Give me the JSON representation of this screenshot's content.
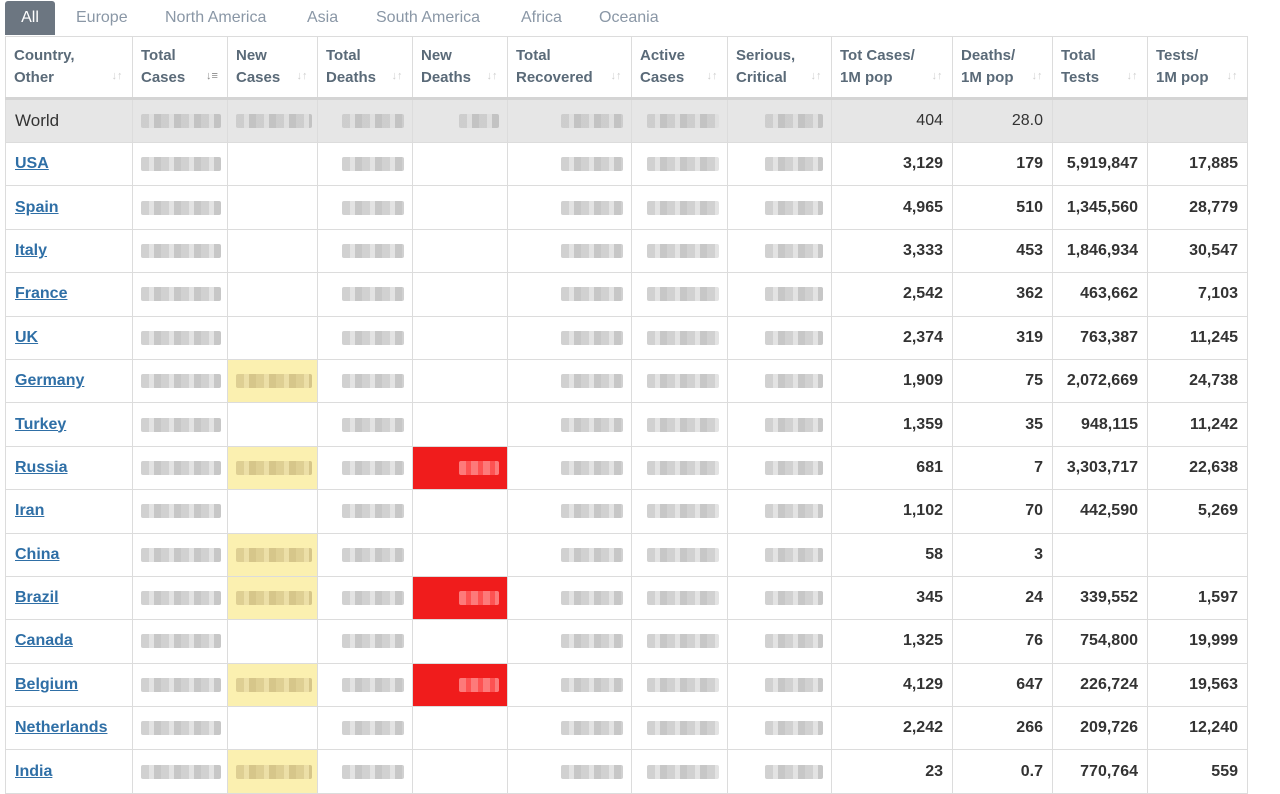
{
  "tabs": [
    {
      "label": "All",
      "active": true
    },
    {
      "label": "Europe"
    },
    {
      "label": "North America"
    },
    {
      "label": "Asia"
    },
    {
      "label": "South America"
    },
    {
      "label": "Africa"
    },
    {
      "label": "Oceania"
    }
  ],
  "headers": [
    {
      "line1": "Country,",
      "line2": "Other"
    },
    {
      "line1": "Total",
      "line2": "Cases",
      "sorted": true
    },
    {
      "line1": "New",
      "line2": "Cases"
    },
    {
      "line1": "Total",
      "line2": "Deaths"
    },
    {
      "line1": "New",
      "line2": "Deaths"
    },
    {
      "line1": "Total",
      "line2": "Recovered"
    },
    {
      "line1": "Active",
      "line2": "Cases"
    },
    {
      "line1": "Serious,",
      "line2": "Critical"
    },
    {
      "line1": "Tot Cases/",
      "line2": "1M pop"
    },
    {
      "line1": "Deaths/",
      "line2": "1M pop"
    },
    {
      "line1": "Total",
      "line2": "Tests"
    },
    {
      "line1": "Tests/",
      "line2": "1M pop"
    }
  ],
  "world": {
    "country": "World",
    "tot_cases_1m": "404",
    "deaths_1m": "28.0",
    "total_tests": "",
    "tests_1m": ""
  },
  "rows": [
    {
      "country": "USA",
      "tot_cases_1m": "3,129",
      "deaths_1m": "179",
      "total_tests": "5,919,847",
      "tests_1m": "17,885",
      "new_cases_highlight": false,
      "new_deaths_highlight": false
    },
    {
      "country": "Spain",
      "tot_cases_1m": "4,965",
      "deaths_1m": "510",
      "total_tests": "1,345,560",
      "tests_1m": "28,779",
      "new_cases_highlight": false,
      "new_deaths_highlight": false
    },
    {
      "country": "Italy",
      "tot_cases_1m": "3,333",
      "deaths_1m": "453",
      "total_tests": "1,846,934",
      "tests_1m": "30,547",
      "new_cases_highlight": false,
      "new_deaths_highlight": false
    },
    {
      "country": "France",
      "tot_cases_1m": "2,542",
      "deaths_1m": "362",
      "total_tests": "463,662",
      "tests_1m": "7,103",
      "new_cases_highlight": false,
      "new_deaths_highlight": false
    },
    {
      "country": "UK",
      "tot_cases_1m": "2,374",
      "deaths_1m": "319",
      "total_tests": "763,387",
      "tests_1m": "11,245",
      "new_cases_highlight": false,
      "new_deaths_highlight": false
    },
    {
      "country": "Germany",
      "tot_cases_1m": "1,909",
      "deaths_1m": "75",
      "total_tests": "2,072,669",
      "tests_1m": "24,738",
      "new_cases_highlight": true,
      "new_deaths_highlight": false
    },
    {
      "country": "Turkey",
      "tot_cases_1m": "1,359",
      "deaths_1m": "35",
      "total_tests": "948,115",
      "tests_1m": "11,242",
      "new_cases_highlight": false,
      "new_deaths_highlight": false
    },
    {
      "country": "Russia",
      "tot_cases_1m": "681",
      "deaths_1m": "7",
      "total_tests": "3,303,717",
      "tests_1m": "22,638",
      "new_cases_highlight": true,
      "new_deaths_highlight": true
    },
    {
      "country": "Iran",
      "tot_cases_1m": "1,102",
      "deaths_1m": "70",
      "total_tests": "442,590",
      "tests_1m": "5,269",
      "new_cases_highlight": false,
      "new_deaths_highlight": false
    },
    {
      "country": "China",
      "tot_cases_1m": "58",
      "deaths_1m": "3",
      "total_tests": "",
      "tests_1m": "",
      "new_cases_highlight": true,
      "new_deaths_highlight": false
    },
    {
      "country": "Brazil",
      "tot_cases_1m": "345",
      "deaths_1m": "24",
      "total_tests": "339,552",
      "tests_1m": "1,597",
      "new_cases_highlight": true,
      "new_deaths_highlight": true
    },
    {
      "country": "Canada",
      "tot_cases_1m": "1,325",
      "deaths_1m": "76",
      "total_tests": "754,800",
      "tests_1m": "19,999",
      "new_cases_highlight": false,
      "new_deaths_highlight": false
    },
    {
      "country": "Belgium",
      "tot_cases_1m": "4,129",
      "deaths_1m": "647",
      "total_tests": "226,724",
      "tests_1m": "19,563",
      "new_cases_highlight": true,
      "new_deaths_highlight": true
    },
    {
      "country": "Netherlands",
      "tot_cases_1m": "2,242",
      "deaths_1m": "266",
      "total_tests": "209,726",
      "tests_1m": "12,240",
      "new_cases_highlight": false,
      "new_deaths_highlight": false
    },
    {
      "country": "India",
      "tot_cases_1m": "23",
      "deaths_1m": "0.7",
      "total_tests": "770,764",
      "tests_1m": "559",
      "new_cases_highlight": true,
      "new_deaths_highlight": false
    }
  ],
  "colors": {
    "tab_active_bg": "#6c7681",
    "link": "#2f6fa6",
    "new_cases_highlight": "#fbf0b0",
    "new_deaths_highlight": "#f01c1c",
    "world_row_bg": "#e6e6e6"
  }
}
